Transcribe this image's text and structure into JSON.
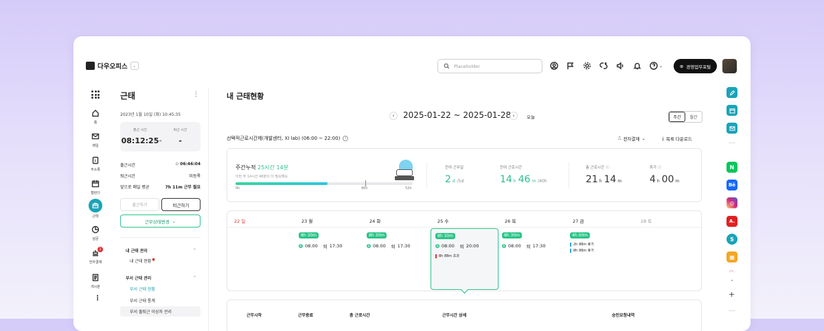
{
  "app": {
    "logo_text": "다우오피스",
    "search_placeholder": "Placeholder",
    "portal_label": "경영업무포털"
  },
  "leftnav": [
    {
      "label": "홈",
      "icon": "home-icon"
    },
    {
      "label": "메일",
      "icon": "mail-icon"
    },
    {
      "label": "주소록",
      "icon": "contacts-icon"
    },
    {
      "label": "캘린더",
      "icon": "calendar-icon"
    },
    {
      "label": "근태",
      "icon": "briefcase-icon"
    },
    {
      "label": "설문",
      "icon": "pie-icon"
    },
    {
      "label": "전자결재",
      "icon": "approval-icon",
      "badge": "1"
    },
    {
      "label": "게시판",
      "icon": "board-icon"
    }
  ],
  "attendance": {
    "title": "근태",
    "datetime": "2023년 1월 10일 (화) 10:45:35",
    "clock_in_label": "출근 시간",
    "clock_out_label": "퇴근 시간",
    "clock_in_value": "08:12:25",
    "clock_out_value": "-",
    "rows": [
      {
        "label": "출근시간",
        "value": "06:46:04"
      },
      {
        "label": "퇴근시간",
        "value": "미등록"
      },
      {
        "label": "앞으로 매일 평균",
        "value": "7h 11m 근무 필요"
      }
    ],
    "btn_in": "출근하기",
    "btn_out": "퇴근하기",
    "btn_status": "근무상태변경",
    "menu": {
      "group1": "내 근태 관리",
      "group1_items": [
        "내 근태 현황"
      ],
      "group2": "부서 근태 관리",
      "group2_items": [
        "부서 근태 현황",
        "부서 근태 통계",
        "부서 출퇴근 이상자 관리"
      ]
    }
  },
  "main": {
    "title": "내 근태현황",
    "range": "2025-01-22 ~ 2025-01-28",
    "today": "오늘",
    "view_week": "주간",
    "view_month": "월간",
    "worksystem": "선택적근로시간제(개발센터, XI lab) (06:00 ~ 22:00)",
    "approval_btn": "전자결재",
    "download_btn": "목록 다운로드",
    "weekly": {
      "label": "주간누적",
      "value": "25시간 14분",
      "sub": "이번 주 14시간 48분이 더 필요해요.",
      "progress": 0.52,
      "ticks": [
        "0h",
        "40h",
        "52h"
      ]
    },
    "stats": [
      {
        "label": "잔여 근무일",
        "num1": "2",
        "unit1": "d",
        "suffix": "/5d",
        "color": "green"
      },
      {
        "label": "잔여 근로시간",
        "num1": "14",
        "unit1": "h",
        "num2": "46",
        "unit2": "m",
        "suffix": "/40h",
        "color": "green"
      },
      {
        "label": "총 근로시간",
        "num1": "21",
        "unit1": "h",
        "num2": "14",
        "unit2": "m",
        "color": "dark"
      },
      {
        "label": "휴가",
        "num1": "4",
        "unit1": "h",
        "num2": "00",
        "unit2": "m",
        "color": "dark"
      }
    ],
    "days": [
      {
        "date": "22",
        "dow": "일",
        "color": "#e03131"
      },
      {
        "date": "23",
        "dow": "월",
        "badge": "8h 30m",
        "in": "08:00",
        "out": "17:30"
      },
      {
        "date": "24",
        "dow": "화",
        "badge": "8h 30m",
        "in": "08:00",
        "out": "17:30"
      },
      {
        "date": "25",
        "dow": "수",
        "badge": "8h 30m",
        "in": "08:00",
        "out": "20:00",
        "extra": "8h 88m  초과"
      },
      {
        "date": "26",
        "dow": "목",
        "badge": "8h 30m",
        "in": "08:00",
        "out": "17:30"
      },
      {
        "date": "27",
        "dow": "금",
        "badge": "4h 00m",
        "leaves": [
          "2h 88m  휴가",
          "8h 88m  휴가"
        ]
      },
      {
        "date": "28",
        "dow": "토",
        "color": "#999"
      }
    ],
    "in_label": "출",
    "out_label": "퇴",
    "table_headers": [
      "근무시작",
      "근무종료",
      "총 근로시간",
      "근무시간 상세",
      "승인요청내역"
    ]
  },
  "right_tiles": [
    {
      "icon": "edit-icon",
      "bg": "#1aa3b8",
      "text": ""
    },
    {
      "icon": "calendar-icon",
      "bg": "#1aa3b8",
      "text": ""
    },
    {
      "icon": "mail-icon",
      "bg": "#1aa3b8",
      "text": ""
    },
    {
      "icon": "naver-icon",
      "bg": "#03c75a",
      "text": "N"
    },
    {
      "icon": "behance-icon",
      "bg": "#1769ff",
      "text": "Bē"
    },
    {
      "icon": "instagram-icon",
      "bg": "#d62976",
      "text": "◎"
    },
    {
      "icon": "acrobat-icon",
      "bg": "#e02020",
      "text": "A."
    },
    {
      "icon": "s-icon",
      "bg": "#1aa3b8",
      "text": "S"
    },
    {
      "icon": "calculator-icon",
      "bg": "#f5a623",
      "text": "▦"
    }
  ]
}
